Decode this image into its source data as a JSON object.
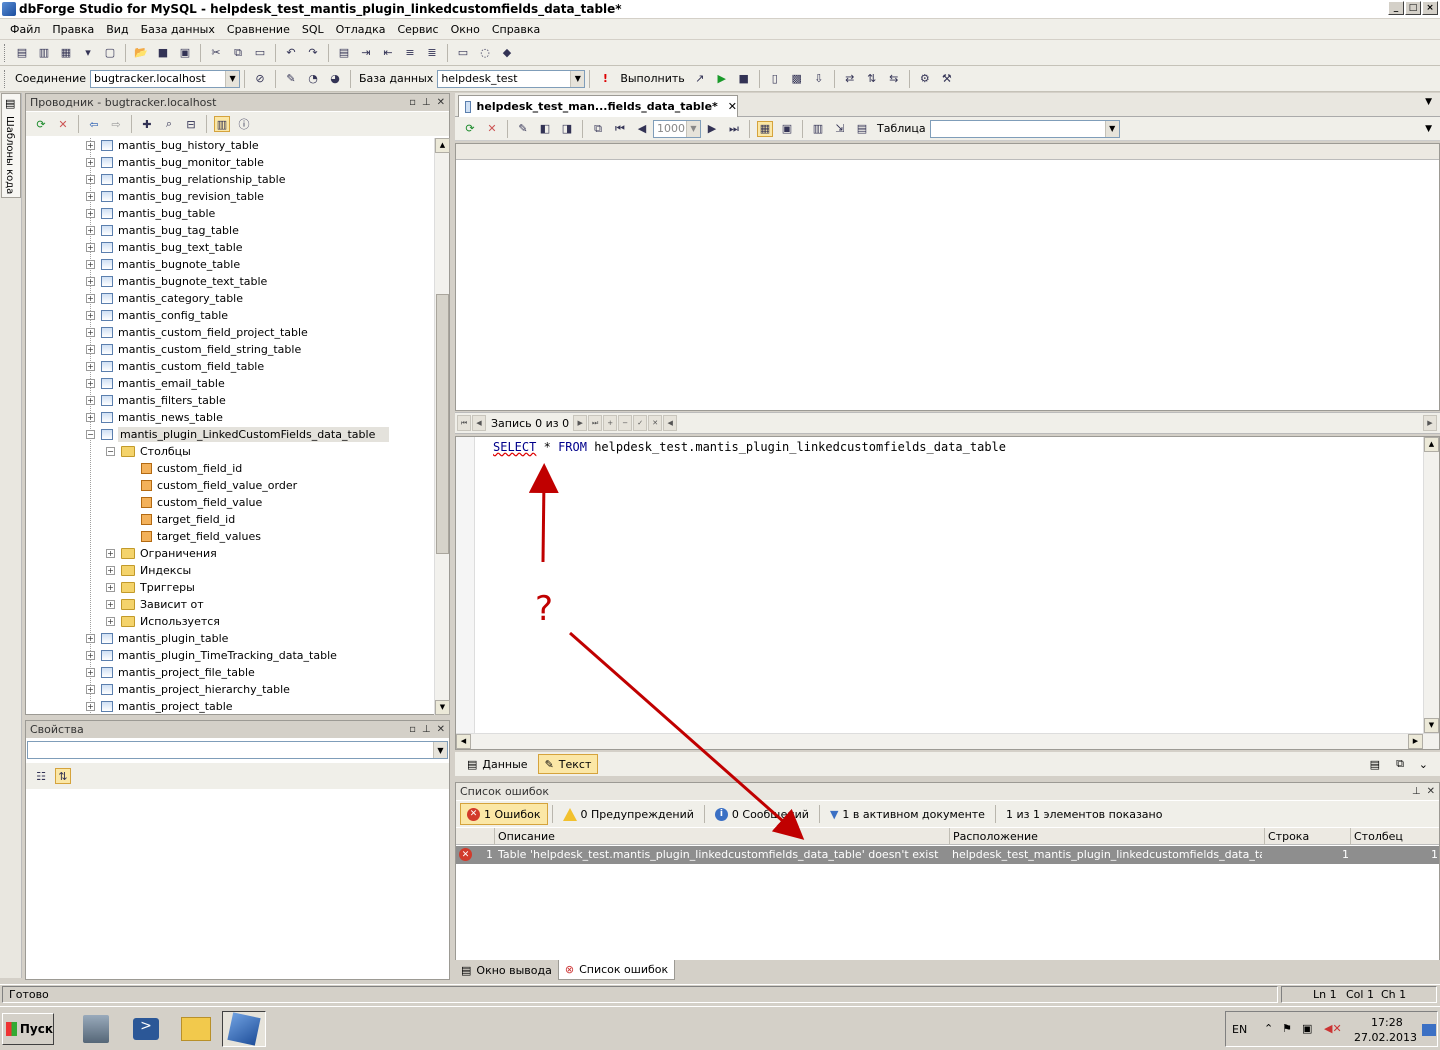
{
  "window": {
    "title": "dbForge Studio for MySQL - helpdesk_test_mantis_plugin_linkedcustomfields_data_table*",
    "buttons": [
      "_",
      "□",
      "×"
    ]
  },
  "menu": [
    "Файл",
    "Правка",
    "Вид",
    "База данных",
    "Сравнение",
    "SQL",
    "Отладка",
    "Сервис",
    "Окно",
    "Справка"
  ],
  "connection_toolbar": {
    "connection_label": "Соединение",
    "connection_value": "bugtracker.localhost",
    "database_label": "База данных",
    "database_value": "helpdesk_test",
    "execute_label": "Выполнить"
  },
  "left_sidebar": {
    "tab_label": "Шаблоны кода"
  },
  "explorer": {
    "title": "Проводник - bugtracker.localhost",
    "nodes": [
      {
        "label": "mantis_bug_history_table",
        "type": "table",
        "level": 0
      },
      {
        "label": "mantis_bug_monitor_table",
        "type": "table",
        "level": 0
      },
      {
        "label": "mantis_bug_relationship_table",
        "type": "table",
        "level": 0
      },
      {
        "label": "mantis_bug_revision_table",
        "type": "table",
        "level": 0
      },
      {
        "label": "mantis_bug_table",
        "type": "table",
        "level": 0
      },
      {
        "label": "mantis_bug_tag_table",
        "type": "table",
        "level": 0
      },
      {
        "label": "mantis_bug_text_table",
        "type": "table",
        "level": 0
      },
      {
        "label": "mantis_bugnote_table",
        "type": "table",
        "level": 0
      },
      {
        "label": "mantis_bugnote_text_table",
        "type": "table",
        "level": 0
      },
      {
        "label": "mantis_category_table",
        "type": "table",
        "level": 0
      },
      {
        "label": "mantis_config_table",
        "type": "table",
        "level": 0
      },
      {
        "label": "mantis_custom_field_project_table",
        "type": "table",
        "level": 0
      },
      {
        "label": "mantis_custom_field_string_table",
        "type": "table",
        "level": 0
      },
      {
        "label": "mantis_custom_field_table",
        "type": "table",
        "level": 0
      },
      {
        "label": "mantis_email_table",
        "type": "table",
        "level": 0
      },
      {
        "label": "mantis_filters_table",
        "type": "table",
        "level": 0
      },
      {
        "label": "mantis_news_table",
        "type": "table",
        "level": 0
      },
      {
        "label": "mantis_plugin_LinkedCustomFields_data_table",
        "type": "table-expanded",
        "level": 0
      },
      {
        "label": "Столбцы",
        "type": "folder-expanded",
        "level": 1
      },
      {
        "label": "custom_field_id",
        "type": "column",
        "level": 2
      },
      {
        "label": "custom_field_value_order",
        "type": "column",
        "level": 2
      },
      {
        "label": "custom_field_value",
        "type": "column",
        "level": 2
      },
      {
        "label": "target_field_id",
        "type": "column",
        "level": 2
      },
      {
        "label": "target_field_values",
        "type": "column",
        "level": 2
      },
      {
        "label": "Ограничения",
        "type": "folder",
        "level": 1
      },
      {
        "label": "Индексы",
        "type": "folder",
        "level": 1
      },
      {
        "label": "Триггеры",
        "type": "folder",
        "level": 1
      },
      {
        "label": "Зависит от",
        "type": "folder",
        "level": 1
      },
      {
        "label": "Используется",
        "type": "folder",
        "level": 1
      },
      {
        "label": "mantis_plugin_table",
        "type": "table",
        "level": 0
      },
      {
        "label": "mantis_plugin_TimeTracking_data_table",
        "type": "table",
        "level": 0
      },
      {
        "label": "mantis_project_file_table",
        "type": "table",
        "level": 0
      },
      {
        "label": "mantis_project_hierarchy_table",
        "type": "table",
        "level": 0
      },
      {
        "label": "mantis_project_table",
        "type": "table",
        "level": 0
      }
    ]
  },
  "properties": {
    "title": "Свойства"
  },
  "document": {
    "tab_label": "helpdesk_test_man...fields_data_table*",
    "limit_value": "1000",
    "table_label": "Таблица",
    "record_nav": "Запись 0 из 0",
    "sql_keyword_select": "SELECT",
    "sql_star": "*",
    "sql_keyword_from": "FROM",
    "sql_table": "helpdesk_test.mantis_plugin_linkedcustomfields_data_table",
    "view_data": "Данные",
    "view_text": "Текст"
  },
  "error_list": {
    "title": "Список ошибок",
    "errors_filter": "1 Ошибок",
    "warnings_filter": "0 Предупреждений",
    "messages_filter": "0 Сообщений",
    "active_doc_filter": "1 в активном документе",
    "shown": "1 из 1 элементов показано",
    "columns": {
      "description": "Описание",
      "location": "Расположение",
      "line": "Строка",
      "column": "Столбец"
    },
    "rows": [
      {
        "number": "1",
        "description": "Table 'helpdesk_test.mantis_plugin_linkedcustomfields_data_table' doesn't exist",
        "location": "helpdesk_test_mantis_plugin_linkedcustomfields_data_table.sql",
        "line": "1",
        "column": "1"
      }
    ]
  },
  "bottom_tabs": {
    "output": "Окно вывода",
    "errors": "Список ошибок"
  },
  "statusbar": {
    "status": "Готово",
    "ln": "Ln 1",
    "col": "Col 1",
    "ch": "Ch 1"
  },
  "taskbar": {
    "start": "Пуск",
    "lang": "EN",
    "time": "17:28",
    "date": "27.02.2013"
  },
  "annotation": {
    "mark": "?",
    "color": "#c00000"
  }
}
